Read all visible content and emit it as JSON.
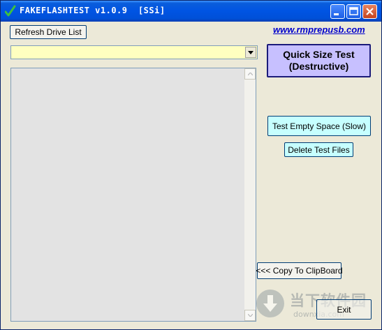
{
  "window": {
    "title": "FAKEFLASHTEST v1.0.9  [SSi]"
  },
  "toolbar": {
    "refresh_drive_list": "Refresh Drive List",
    "website_link": "www.rmprepusb.com"
  },
  "drive_select": {
    "selected": ""
  },
  "actions": {
    "quick_size_test_line1": "Quick Size Test",
    "quick_size_test_line2": "(Destructive)",
    "test_empty_space": "Test Empty Space (Slow)",
    "delete_test_files": "Delete Test Files",
    "copy_to_clipboard": "<<< Copy To ClipBoard",
    "exit": "Exit"
  },
  "watermark": {
    "brand_cn": "当下软件园",
    "url": "downxia.com"
  },
  "colors": {
    "titlebar": "#0054e3",
    "window_bg": "#ece9d8",
    "combo_bg": "#ffffc0",
    "quick_test_bg": "#c7c0ff",
    "cyan_button_bg": "#c6ffff",
    "link": "#0000cc"
  }
}
